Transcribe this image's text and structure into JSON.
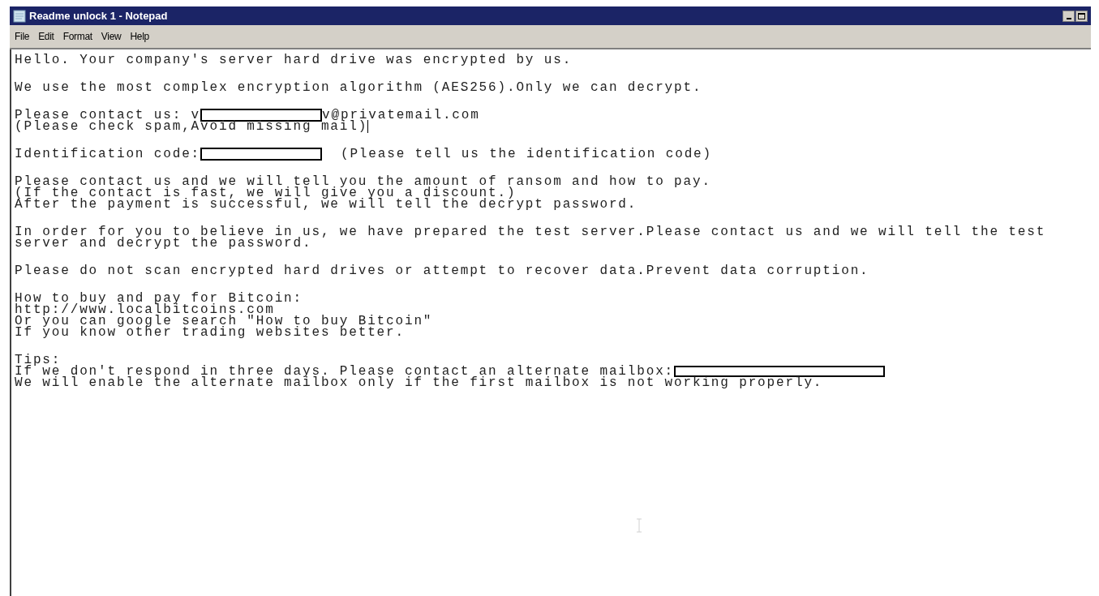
{
  "window": {
    "title": "Readme unlock 1 - Notepad"
  },
  "menu": [
    "File",
    "Edit",
    "Format",
    "View",
    "Help"
  ],
  "paragraphs": [
    [
      [
        {
          "kind": "text",
          "text": "Hello. Your company's server hard drive was encrypted by us."
        }
      ]
    ],
    [
      [
        {
          "kind": "text",
          "text": "We use the most complex encryption algorithm (AES256).Only we can decrypt."
        }
      ]
    ],
    [
      [
        {
          "kind": "text",
          "text": "Please contact us: v"
        },
        {
          "kind": "redacted"
        },
        {
          "kind": "text",
          "text": "v@privatemail.com"
        }
      ],
      [
        {
          "kind": "text",
          "text": "(Please check spam,Avoid missing mail)"
        },
        {
          "kind": "caret"
        }
      ]
    ],
    [
      [
        {
          "kind": "text",
          "text": "Identification code:"
        },
        {
          "kind": "redacted"
        },
        {
          "kind": "text",
          "text": "  (Please tell us the identification code)"
        }
      ]
    ],
    [
      [
        {
          "kind": "text",
          "text": "Please contact us and we will tell you the amount of ransom and how to pay."
        }
      ],
      [
        {
          "kind": "text",
          "text": "(If the contact is fast, we will give you a discount.)"
        }
      ],
      [
        {
          "kind": "text",
          "text": "After the payment is successful, we will tell the decrypt password."
        }
      ]
    ],
    [
      [
        {
          "kind": "text",
          "text": "In order for you to believe in us, we have prepared the test server.Please contact us and we will tell the test"
        }
      ],
      [
        {
          "kind": "text",
          "text": "server and decrypt the password."
        }
      ]
    ],
    [
      [
        {
          "kind": "text",
          "text": "Please do not scan encrypted hard drives or attempt to recover data.Prevent data corruption."
        }
      ]
    ],
    [
      [
        {
          "kind": "text",
          "text": "How to buy and pay for Bitcoin:"
        }
      ],
      [
        {
          "kind": "text",
          "text": "http://www.localbitcoins.com"
        }
      ],
      [
        {
          "kind": "text",
          "text": "Or you can google search \"How to buy Bitcoin\""
        }
      ],
      [
        {
          "kind": "text",
          "text": "If you know other trading websites better."
        }
      ]
    ],
    [
      [
        {
          "kind": "text",
          "text": "Tips:"
        }
      ],
      [
        {
          "kind": "text",
          "text": "If we don't respond in three days. Please contact an alternate mailbox:"
        },
        {
          "kind": "redacted_wide"
        }
      ],
      [
        {
          "kind": "text",
          "text": "We will enable the alternate mailbox only if the first mailbox is not working properly."
        }
      ]
    ]
  ]
}
